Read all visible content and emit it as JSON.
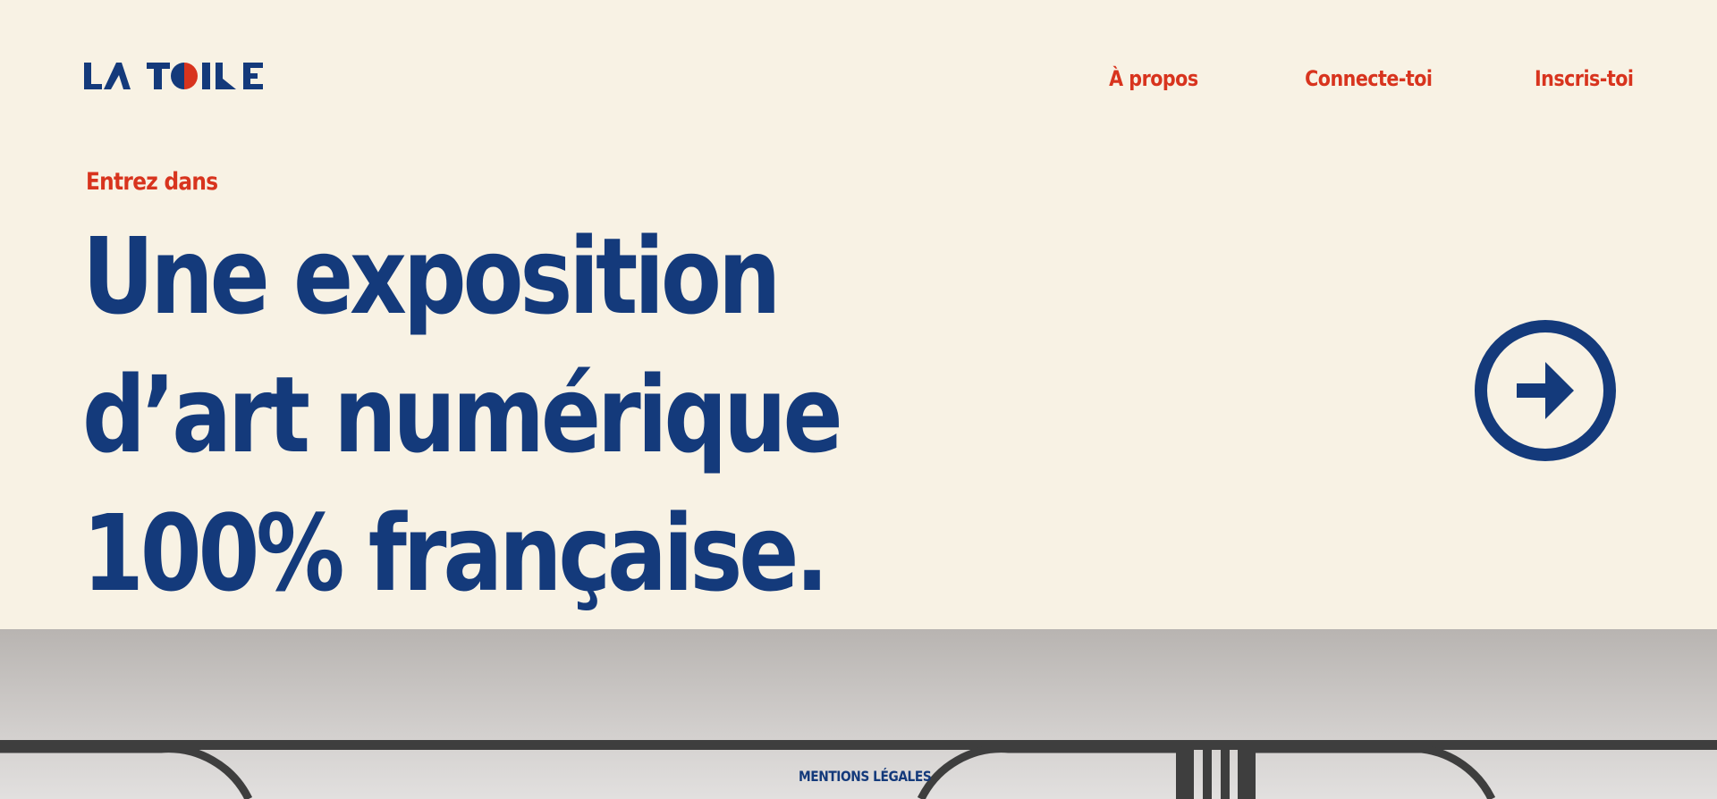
{
  "header": {
    "logo_text": "LA TOILE",
    "nav": [
      {
        "label": "À propos"
      },
      {
        "label": "Connecte-toi"
      },
      {
        "label": "Inscris-toi"
      }
    ]
  },
  "hero": {
    "kicker": "Entrez dans",
    "headline_lines": [
      "Une exposition",
      "d’art numérique",
      "100% française."
    ],
    "cta_icon": "arrow-right-circle-icon"
  },
  "footer": {
    "legal_label": "MENTIONS LÉGALES"
  },
  "colors": {
    "background": "#f8f2e4",
    "primary_blue": "#143a7b",
    "accent_red": "#d8341e",
    "footer_gray": "#c8c5c3",
    "rail_dark": "#3e3e3e"
  }
}
